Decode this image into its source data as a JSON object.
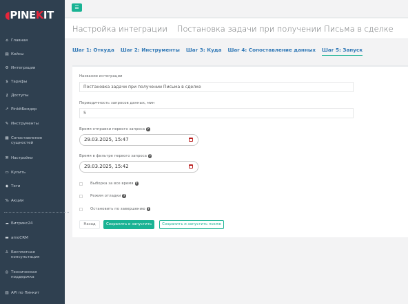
{
  "brand": {
    "logo_text_1": "PI",
    "logo_text_2": "NE",
    "logo_x": "K",
    "logo_text_3": "IT"
  },
  "topbar": {
    "menu_icon": "☰"
  },
  "sidebar": {
    "items": [
      {
        "icon": "⌂",
        "label": "Главная"
      },
      {
        "icon": "▤",
        "label": "Кейсы"
      },
      {
        "icon": "⚙",
        "label": "Интеграции"
      },
      {
        "icon": "$",
        "label": "Тарифы"
      },
      {
        "icon": "⚷",
        "label": "Доступы"
      },
      {
        "icon": "↗",
        "label": "PinkitБилдер"
      },
      {
        "icon": "✎",
        "label": "Инструменты"
      },
      {
        "icon": "▦",
        "label": "Сопоставление сущностей"
      },
      {
        "icon": "⚒",
        "label": "Настройки"
      },
      {
        "icon": "▭",
        "label": "Купить"
      },
      {
        "icon": "◆",
        "label": "Теги"
      },
      {
        "icon": "%",
        "label": "Акции"
      }
    ],
    "items2": [
      {
        "icon": "☁",
        "label": "Битрикс24"
      },
      {
        "icon": "▬",
        "label": "amoCRM"
      },
      {
        "icon": "♙",
        "label": "Бесплатная консультация"
      },
      {
        "icon": "◎",
        "label": "Техническая поддержка"
      },
      {
        "icon": "▥",
        "label": "API по Пинкит"
      }
    ]
  },
  "header": {
    "title": "Настройка интеграции",
    "subtitle": "Постановка задачи при получении Письма в сделке"
  },
  "tabs": [
    {
      "label": "Шаг 1: Откуда"
    },
    {
      "label": "Шаг 2: Инструменты"
    },
    {
      "label": "Шаг 3: Куда"
    },
    {
      "label": "Шаг 4: Сопоставление данных"
    },
    {
      "label": "Шаг 5: Запуск"
    }
  ],
  "form": {
    "name_label": "Название интеграции",
    "name_value": "Постановка задачи при получении Письма в сделке",
    "period_label": "Периодичность запросов данных, мин",
    "period_value": "5",
    "first_request_label": "Время отправки первого запроса",
    "first_request_value": "29.03.2025, 15:47",
    "filter_label": "Время в фильтре первого запроса",
    "filter_value": "29.03.2025, 15:42",
    "help_glyph": "?",
    "check_all_time": "Выборка за все время",
    "check_debug": "Режим отладки",
    "check_stop": "Остановить по завершению",
    "btn_back": "Назад",
    "btn_save_start": "Сохранить и запустить",
    "btn_save_later": "Сохранить и запустить позже"
  },
  "colors": {
    "sidebar": "#2f4050",
    "accent": "#1ab394",
    "link": "#337ab7",
    "brand_red": "#e8253a"
  }
}
